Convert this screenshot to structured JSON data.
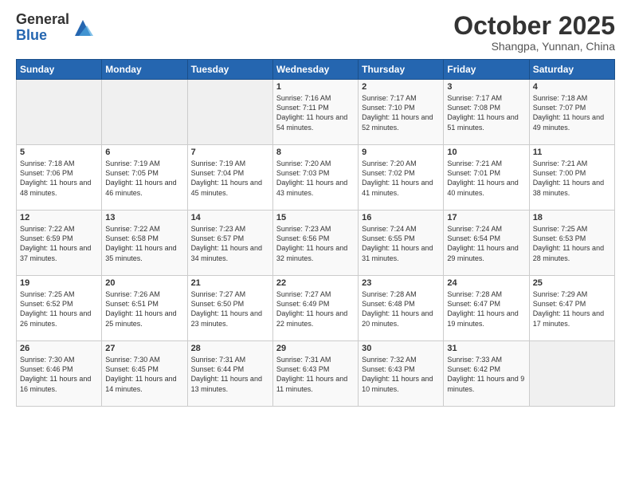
{
  "header": {
    "logo_general": "General",
    "logo_blue": "Blue",
    "month": "October 2025",
    "location": "Shangpa, Yunnan, China"
  },
  "days_of_week": [
    "Sunday",
    "Monday",
    "Tuesday",
    "Wednesday",
    "Thursday",
    "Friday",
    "Saturday"
  ],
  "weeks": [
    [
      {
        "day": "",
        "empty": true
      },
      {
        "day": "",
        "empty": true
      },
      {
        "day": "",
        "empty": true
      },
      {
        "day": "1",
        "sunrise": "Sunrise: 7:16 AM",
        "sunset": "Sunset: 7:11 PM",
        "daylight": "Daylight: 11 hours and 54 minutes."
      },
      {
        "day": "2",
        "sunrise": "Sunrise: 7:17 AM",
        "sunset": "Sunset: 7:10 PM",
        "daylight": "Daylight: 11 hours and 52 minutes."
      },
      {
        "day": "3",
        "sunrise": "Sunrise: 7:17 AM",
        "sunset": "Sunset: 7:08 PM",
        "daylight": "Daylight: 11 hours and 51 minutes."
      },
      {
        "day": "4",
        "sunrise": "Sunrise: 7:18 AM",
        "sunset": "Sunset: 7:07 PM",
        "daylight": "Daylight: 11 hours and 49 minutes."
      }
    ],
    [
      {
        "day": "5",
        "sunrise": "Sunrise: 7:18 AM",
        "sunset": "Sunset: 7:06 PM",
        "daylight": "Daylight: 11 hours and 48 minutes."
      },
      {
        "day": "6",
        "sunrise": "Sunrise: 7:19 AM",
        "sunset": "Sunset: 7:05 PM",
        "daylight": "Daylight: 11 hours and 46 minutes."
      },
      {
        "day": "7",
        "sunrise": "Sunrise: 7:19 AM",
        "sunset": "Sunset: 7:04 PM",
        "daylight": "Daylight: 11 hours and 45 minutes."
      },
      {
        "day": "8",
        "sunrise": "Sunrise: 7:20 AM",
        "sunset": "Sunset: 7:03 PM",
        "daylight": "Daylight: 11 hours and 43 minutes."
      },
      {
        "day": "9",
        "sunrise": "Sunrise: 7:20 AM",
        "sunset": "Sunset: 7:02 PM",
        "daylight": "Daylight: 11 hours and 41 minutes."
      },
      {
        "day": "10",
        "sunrise": "Sunrise: 7:21 AM",
        "sunset": "Sunset: 7:01 PM",
        "daylight": "Daylight: 11 hours and 40 minutes."
      },
      {
        "day": "11",
        "sunrise": "Sunrise: 7:21 AM",
        "sunset": "Sunset: 7:00 PM",
        "daylight": "Daylight: 11 hours and 38 minutes."
      }
    ],
    [
      {
        "day": "12",
        "sunrise": "Sunrise: 7:22 AM",
        "sunset": "Sunset: 6:59 PM",
        "daylight": "Daylight: 11 hours and 37 minutes."
      },
      {
        "day": "13",
        "sunrise": "Sunrise: 7:22 AM",
        "sunset": "Sunset: 6:58 PM",
        "daylight": "Daylight: 11 hours and 35 minutes."
      },
      {
        "day": "14",
        "sunrise": "Sunrise: 7:23 AM",
        "sunset": "Sunset: 6:57 PM",
        "daylight": "Daylight: 11 hours and 34 minutes."
      },
      {
        "day": "15",
        "sunrise": "Sunrise: 7:23 AM",
        "sunset": "Sunset: 6:56 PM",
        "daylight": "Daylight: 11 hours and 32 minutes."
      },
      {
        "day": "16",
        "sunrise": "Sunrise: 7:24 AM",
        "sunset": "Sunset: 6:55 PM",
        "daylight": "Daylight: 11 hours and 31 minutes."
      },
      {
        "day": "17",
        "sunrise": "Sunrise: 7:24 AM",
        "sunset": "Sunset: 6:54 PM",
        "daylight": "Daylight: 11 hours and 29 minutes."
      },
      {
        "day": "18",
        "sunrise": "Sunrise: 7:25 AM",
        "sunset": "Sunset: 6:53 PM",
        "daylight": "Daylight: 11 hours and 28 minutes."
      }
    ],
    [
      {
        "day": "19",
        "sunrise": "Sunrise: 7:25 AM",
        "sunset": "Sunset: 6:52 PM",
        "daylight": "Daylight: 11 hours and 26 minutes."
      },
      {
        "day": "20",
        "sunrise": "Sunrise: 7:26 AM",
        "sunset": "Sunset: 6:51 PM",
        "daylight": "Daylight: 11 hours and 25 minutes."
      },
      {
        "day": "21",
        "sunrise": "Sunrise: 7:27 AM",
        "sunset": "Sunset: 6:50 PM",
        "daylight": "Daylight: 11 hours and 23 minutes."
      },
      {
        "day": "22",
        "sunrise": "Sunrise: 7:27 AM",
        "sunset": "Sunset: 6:49 PM",
        "daylight": "Daylight: 11 hours and 22 minutes."
      },
      {
        "day": "23",
        "sunrise": "Sunrise: 7:28 AM",
        "sunset": "Sunset: 6:48 PM",
        "daylight": "Daylight: 11 hours and 20 minutes."
      },
      {
        "day": "24",
        "sunrise": "Sunrise: 7:28 AM",
        "sunset": "Sunset: 6:47 PM",
        "daylight": "Daylight: 11 hours and 19 minutes."
      },
      {
        "day": "25",
        "sunrise": "Sunrise: 7:29 AM",
        "sunset": "Sunset: 6:47 PM",
        "daylight": "Daylight: 11 hours and 17 minutes."
      }
    ],
    [
      {
        "day": "26",
        "sunrise": "Sunrise: 7:30 AM",
        "sunset": "Sunset: 6:46 PM",
        "daylight": "Daylight: 11 hours and 16 minutes."
      },
      {
        "day": "27",
        "sunrise": "Sunrise: 7:30 AM",
        "sunset": "Sunset: 6:45 PM",
        "daylight": "Daylight: 11 hours and 14 minutes."
      },
      {
        "day": "28",
        "sunrise": "Sunrise: 7:31 AM",
        "sunset": "Sunset: 6:44 PM",
        "daylight": "Daylight: 11 hours and 13 minutes."
      },
      {
        "day": "29",
        "sunrise": "Sunrise: 7:31 AM",
        "sunset": "Sunset: 6:43 PM",
        "daylight": "Daylight: 11 hours and 11 minutes."
      },
      {
        "day": "30",
        "sunrise": "Sunrise: 7:32 AM",
        "sunset": "Sunset: 6:43 PM",
        "daylight": "Daylight: 11 hours and 10 minutes."
      },
      {
        "day": "31",
        "sunrise": "Sunrise: 7:33 AM",
        "sunset": "Sunset: 6:42 PM",
        "daylight": "Daylight: 11 hours and 9 minutes."
      },
      {
        "day": "",
        "empty": true
      }
    ]
  ]
}
